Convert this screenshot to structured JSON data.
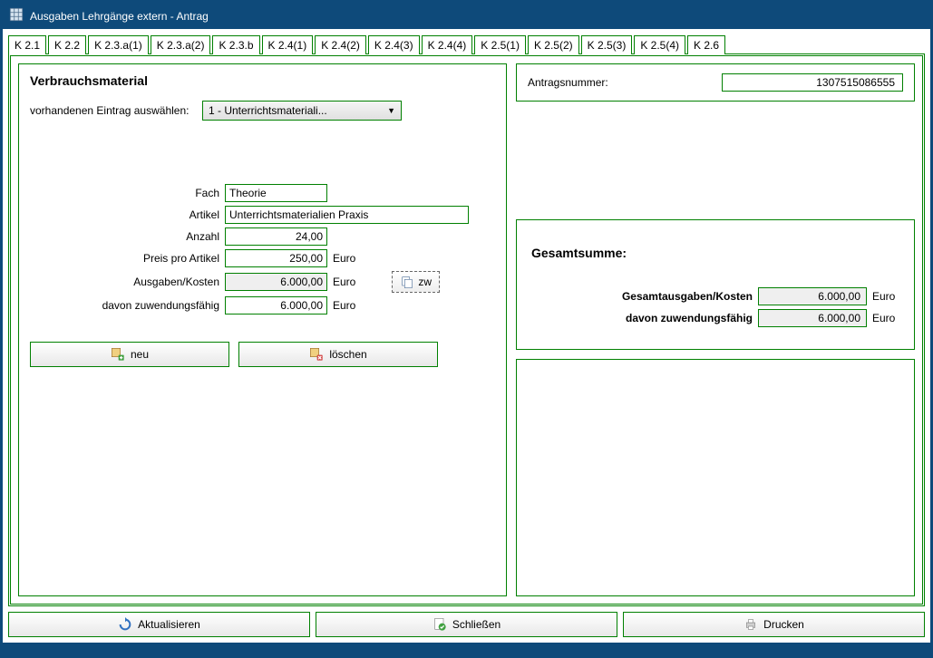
{
  "window": {
    "title": "Ausgaben Lehrgänge extern - Antrag"
  },
  "tabs": [
    "K 2.1",
    "K 2.2",
    "K 2.3.a(1)",
    "K 2.3.a(2)",
    "K 2.3.b",
    "K 2.4(1)",
    "K 2.4(2)",
    "K 2.4(3)",
    "K 2.4(4)",
    "K 2.5(1)",
    "K 2.5(2)",
    "K 2.5(3)",
    "K 2.5(4)",
    "K 2.6"
  ],
  "active_tab": 1,
  "left": {
    "section_title": "Verbrauchsmaterial",
    "selector_label": "vorhandenen Eintrag auswählen:",
    "selector_value": "1 - Unterrichtsmateriali...",
    "fields": {
      "fach": {
        "label": "Fach",
        "value": "Theorie"
      },
      "artikel": {
        "label": "Artikel",
        "value": "Unterrichtsmaterialien Praxis"
      },
      "anzahl": {
        "label": "Anzahl",
        "value": "24,00"
      },
      "preis": {
        "label": "Preis pro Artikel",
        "value": "250,00",
        "unit": "Euro"
      },
      "ausgaben": {
        "label": "Ausgaben/Kosten",
        "value": "6.000,00",
        "unit": "Euro"
      },
      "zuwendung": {
        "label": "davon zuwendungsfähig",
        "value": "6.000,00",
        "unit": "Euro"
      }
    },
    "zw_button": "zw",
    "neu_button": "neu",
    "loeschen_button": "löschen"
  },
  "right": {
    "antragsnummer_label": "Antragsnummer:",
    "antragsnummer_value": "1307515086555",
    "summary_title": "Gesamtsumme:",
    "gesamt": {
      "label": "Gesamtausgaben/Kosten",
      "value": "6.000,00",
      "unit": "Euro"
    },
    "zuwendung": {
      "label": "davon zuwendungsfähig",
      "value": "6.000,00",
      "unit": "Euro"
    }
  },
  "bottom": {
    "aktualisieren": "Aktualisieren",
    "schliessen": "Schließen",
    "drucken": "Drucken"
  }
}
